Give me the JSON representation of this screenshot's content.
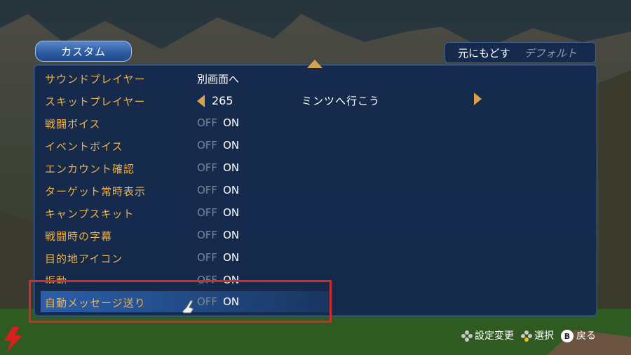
{
  "title": "カスタム",
  "top_actions": [
    "元にもどす",
    "デフォルト"
  ],
  "rows": [
    {
      "label": "サウンドプレイヤー",
      "value": "別画面へ"
    },
    {
      "label": "スキットプレイヤー",
      "number": "265",
      "song": "ミンツへ行こう"
    },
    {
      "label": "戦闘ボイス",
      "off": "OFF",
      "on": "ON"
    },
    {
      "label": "イベントボイス",
      "off": "OFF",
      "on": "ON"
    },
    {
      "label": "エンカウント確認",
      "off": "OFF",
      "on": "ON"
    },
    {
      "label": "ターゲット常時表示",
      "off": "OFF",
      "on": "ON"
    },
    {
      "label": "キャンプスキット",
      "off": "OFF",
      "on": "ON"
    },
    {
      "label": "戦闘時の字幕",
      "off": "OFF",
      "on": "ON"
    },
    {
      "label": "目的地アイコン",
      "off": "OFF",
      "on": "ON"
    },
    {
      "label": "振動",
      "off": "OFF",
      "on": "ON"
    },
    {
      "label": "自動メッセージ送り",
      "off": "OFF",
      "on": "ON"
    }
  ],
  "footer": {
    "change": "設定変更",
    "select": "選択",
    "back_button": "B",
    "back": "戻る"
  },
  "colors": {
    "label": "#f0b34a",
    "accent": "#d6a24a",
    "highlight_box": "#d42a2a"
  }
}
